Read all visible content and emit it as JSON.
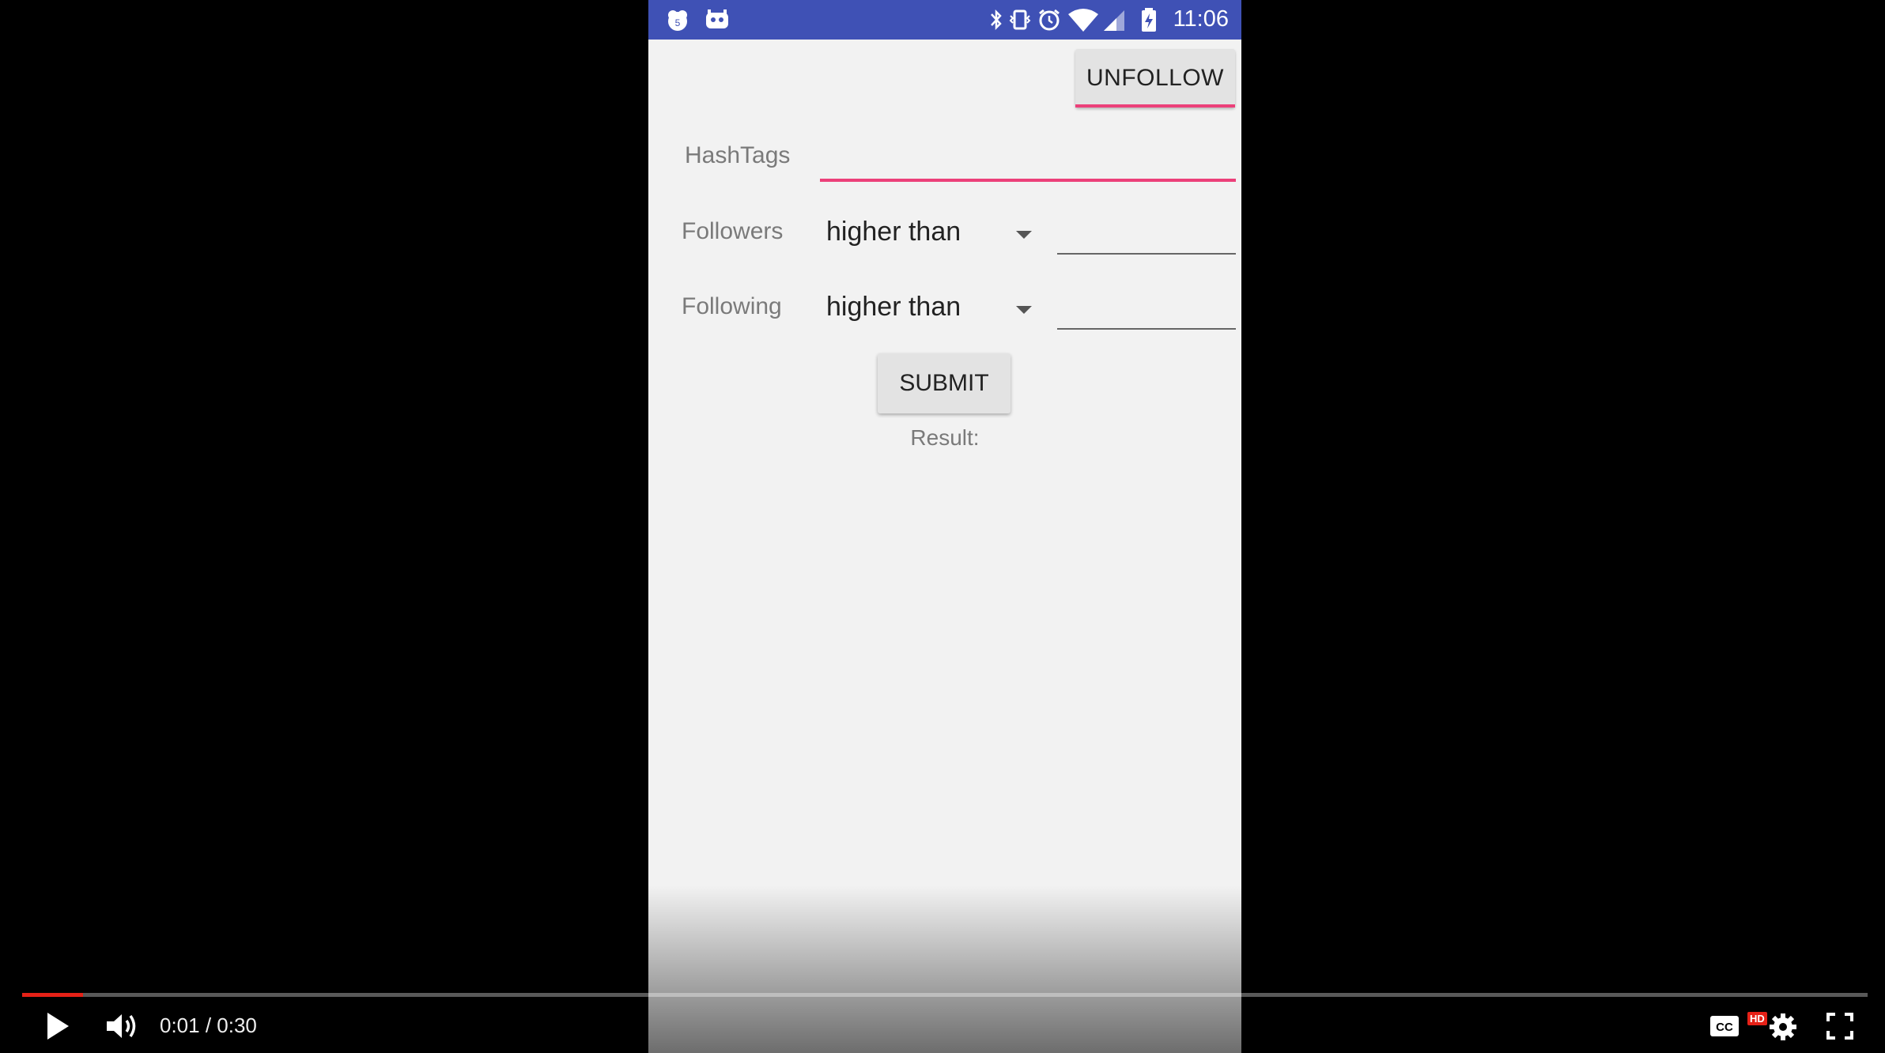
{
  "statusbar": {
    "time": "11:06",
    "icons": [
      "notification-5-icon",
      "android-debug-icon",
      "bluetooth-icon",
      "vibrate-icon",
      "alarm-icon",
      "wifi-icon",
      "signal-icon",
      "battery-charging-icon"
    ],
    "background": "#3f51b5"
  },
  "app": {
    "unfollow_label": "UNFOLLOW",
    "hashtags_label": "HashTags",
    "hashtags_value": "",
    "followers_label": "Followers",
    "followers_selected": "higher than",
    "followers_value": "",
    "following_label": "Following",
    "following_selected": "higher than",
    "following_value": "",
    "submit_label": "SUBMIT",
    "result_label": "Result:",
    "accent": "#ec407a"
  },
  "player": {
    "current_time": "0:01",
    "duration": "0:30",
    "timecode": "0:01 / 0:30",
    "progress_fraction": 0.033,
    "hd_label": "HD",
    "progress_color": "#e62117"
  }
}
